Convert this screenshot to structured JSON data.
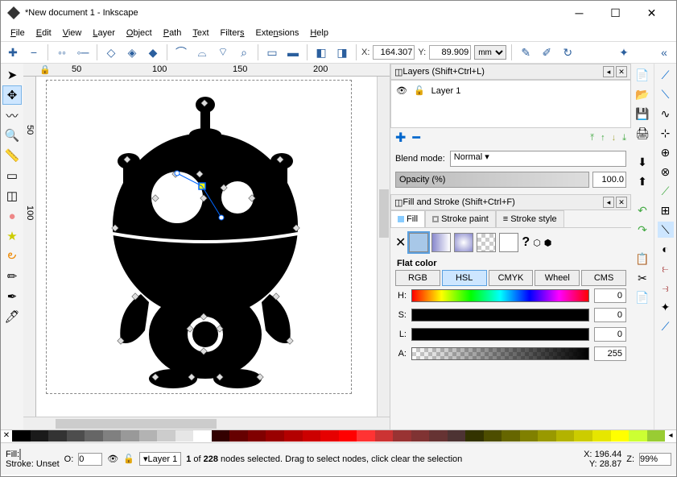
{
  "window": {
    "title": "*New document 1 - Inkscape"
  },
  "menu": [
    "File",
    "Edit",
    "View",
    "Layer",
    "Object",
    "Path",
    "Text",
    "Filters",
    "Extensions",
    "Help"
  ],
  "coords": {
    "x_label": "X:",
    "x": "164.307",
    "y_label": "Y:",
    "y": "89.909",
    "unit": "mm"
  },
  "ruler_h": [
    "50",
    "100",
    "150",
    "200"
  ],
  "ruler_v": [
    "50",
    "100"
  ],
  "layers": {
    "title": "Layers (Shift+Ctrl+L)",
    "layer1": "Layer 1",
    "blend_label": "Blend mode:",
    "blend_value": "Normal",
    "opacity_label": "Opacity (%)",
    "opacity_value": "100.0"
  },
  "fill": {
    "title": "Fill and Stroke (Shift+Ctrl+F)",
    "tab_fill": "Fill",
    "tab_stroke_paint": "Stroke paint",
    "tab_stroke_style": "Stroke style",
    "flat_label": "Flat color",
    "tabs": {
      "rgb": "RGB",
      "hsl": "HSL",
      "cmyk": "CMYK",
      "wheel": "Wheel",
      "cms": "CMS"
    },
    "h_label": "H:",
    "h_val": "0",
    "s_label": "S:",
    "s_val": "0",
    "l_label": "L:",
    "l_val": "0",
    "a_label": "A:",
    "a_val": "255"
  },
  "status": {
    "fill_label": "Fill:",
    "stroke_label": "Stroke:",
    "stroke_value": "Unset",
    "o_label": "O:",
    "o_val": "0",
    "layer_name": "Layer 1",
    "msg": "1 of 228 nodes selected. Drag to select nodes, click clear the selection",
    "x_label": "X:",
    "x_val": "196.44",
    "y_label": "Y:",
    "y_val": "28.87",
    "z_label": "Z:",
    "z_val": "99%"
  },
  "palette": [
    "#000000",
    "#1a1a1a",
    "#333333",
    "#4d4d4d",
    "#666666",
    "#808080",
    "#999999",
    "#b3b3b3",
    "#cccccc",
    "#e6e6e6",
    "#ffffff",
    "#330000",
    "#660000",
    "#800000",
    "#990000",
    "#b30000",
    "#cc0000",
    "#e60000",
    "#ff0000",
    "#ff3333",
    "#cc3333",
    "#993333",
    "#803333",
    "#663333",
    "#4d3333",
    "#333300",
    "#4d4d00",
    "#666600",
    "#808000",
    "#999900",
    "#b3b300",
    "#cccc00",
    "#e6e600",
    "#ffff00",
    "#ccff33",
    "#99cc33"
  ]
}
